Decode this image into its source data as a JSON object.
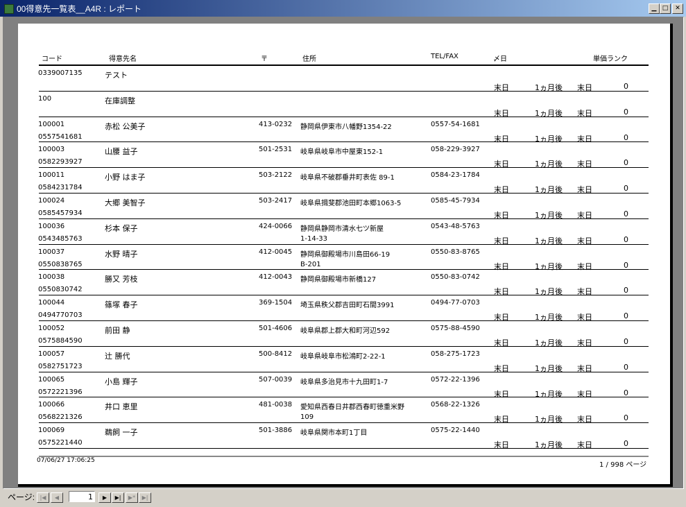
{
  "window": {
    "title": "00得意先一覧表__A4R : レポート"
  },
  "report": {
    "headers": {
      "code": "コード",
      "name": "得意先名",
      "zip": "〒",
      "address": "住所",
      "tel": "TEL/FAX",
      "close": "〆日",
      "rank": "単価ランク"
    },
    "rows": [
      {
        "code": "0339007135",
        "tel_id": "",
        "name": "テスト",
        "zip": "",
        "addr1": "",
        "addr2": "",
        "tel": "",
        "fax": "",
        "close": "末日",
        "month": "1ヵ月後",
        "pay": "末日",
        "rank": "0"
      },
      {
        "code": "100",
        "tel_id": "",
        "name": "在庫調整",
        "zip": "",
        "addr1": "",
        "addr2": "",
        "tel": "",
        "fax": "",
        "close": "末日",
        "month": "1ヵ月後",
        "pay": "末日",
        "rank": "0"
      },
      {
        "code": "100001",
        "tel_id": "0557541681",
        "name": "赤松 公美子",
        "zip": "413-0232",
        "addr1": "静岡県伊東市八幡野1354-22",
        "addr2": "",
        "tel": "0557-54-1681",
        "fax": "",
        "close": "末日",
        "month": "1ヵ月後",
        "pay": "末日",
        "rank": "0"
      },
      {
        "code": "100003",
        "tel_id": "0582293927",
        "name": "山腰 益子",
        "zip": "501-2531",
        "addr1": "岐阜県岐阜市中屋東152-1",
        "addr2": "",
        "tel": "058-229-3927",
        "fax": "",
        "close": "末日",
        "month": "1ヵ月後",
        "pay": "末日",
        "rank": "0"
      },
      {
        "code": "100011",
        "tel_id": "0584231784",
        "name": "小野 はま子",
        "zip": "503-2122",
        "addr1": "岐阜県不破郡垂井町表佐 89-1",
        "addr2": "",
        "tel": "0584-23-1784",
        "fax": "",
        "close": "末日",
        "month": "1ヵ月後",
        "pay": "末日",
        "rank": "0"
      },
      {
        "code": "100024",
        "tel_id": "0585457934",
        "name": "大郷 美智子",
        "zip": "503-2417",
        "addr1": "岐阜県揖斐郡池田町本郷1063-5",
        "addr2": "",
        "tel": "0585-45-7934",
        "fax": "",
        "close": "末日",
        "month": "1ヵ月後",
        "pay": "末日",
        "rank": "0"
      },
      {
        "code": "100036",
        "tel_id": "0543485763",
        "name": "杉本 保子",
        "zip": "424-0066",
        "addr1": "静岡県静岡市清水七ツ新屋",
        "addr2": "1-14-33",
        "tel": "0543-48-5763",
        "fax": "",
        "close": "末日",
        "month": "1ヵ月後",
        "pay": "末日",
        "rank": "0"
      },
      {
        "code": "100037",
        "tel_id": "0550838765",
        "name": "水野 晴子",
        "zip": "412-0045",
        "addr1": "静岡県御殿場市川島田66-19",
        "addr2": "B-201",
        "tel": "0550-83-8765",
        "fax": "",
        "close": "末日",
        "month": "1ヵ月後",
        "pay": "末日",
        "rank": "0"
      },
      {
        "code": "100038",
        "tel_id": "0550830742",
        "name": "勝又 芳枝",
        "zip": "412-0043",
        "addr1": "静岡県御殿場市新橋127",
        "addr2": "",
        "tel": "0550-83-0742",
        "fax": "",
        "close": "末日",
        "month": "1ヵ月後",
        "pay": "末日",
        "rank": "0"
      },
      {
        "code": "100044",
        "tel_id": "0494770703",
        "name": "篠塚 春子",
        "zip": "369-1504",
        "addr1": "埼玉県秩父郡吉田町石間3991",
        "addr2": "",
        "tel": "0494-77-0703",
        "fax": "",
        "close": "末日",
        "month": "1ヵ月後",
        "pay": "末日",
        "rank": "0"
      },
      {
        "code": "100052",
        "tel_id": "0575884590",
        "name": "前田 静",
        "zip": "501-4606",
        "addr1": "岐阜県郡上郡大和町河辺592",
        "addr2": "",
        "tel": "0575-88-4590",
        "fax": "",
        "close": "末日",
        "month": "1ヵ月後",
        "pay": "末日",
        "rank": "0"
      },
      {
        "code": "100057",
        "tel_id": "0582751723",
        "name": "辻 勝代",
        "zip": "500-8412",
        "addr1": "岐阜県岐阜市松鴻町2-22-1",
        "addr2": "",
        "tel": "058-275-1723",
        "fax": "",
        "close": "末日",
        "month": "1ヵ月後",
        "pay": "末日",
        "rank": "0"
      },
      {
        "code": "100065",
        "tel_id": "0572221396",
        "name": "小島 輝子",
        "zip": "507-0039",
        "addr1": "岐阜県多治見市十九田町1-7",
        "addr2": "",
        "tel": "0572-22-1396",
        "fax": "",
        "close": "末日",
        "month": "1ヵ月後",
        "pay": "末日",
        "rank": "0"
      },
      {
        "code": "100066",
        "tel_id": "0568221326",
        "name": "井口 恵里",
        "zip": "481-0038",
        "addr1": "愛知県西春日井郡西春町徳重米野",
        "addr2": "109",
        "tel": "0568-22-1326",
        "fax": "",
        "close": "末日",
        "month": "1ヵ月後",
        "pay": "末日",
        "rank": "0"
      },
      {
        "code": "100069",
        "tel_id": "0575221440",
        "name": "鵜飼 一子",
        "zip": "501-3886",
        "addr1": "岐阜県関市本町1丁目",
        "addr2": "",
        "tel": "0575-22-1440",
        "fax": "",
        "close": "末日",
        "month": "1ヵ月後",
        "pay": "末日",
        "rank": "0"
      }
    ],
    "footer": {
      "timestamp": "07/06/27 17:06:25",
      "page": "1 / 998 ページ"
    }
  },
  "nav": {
    "label": "ページ:",
    "current_page": "1"
  }
}
